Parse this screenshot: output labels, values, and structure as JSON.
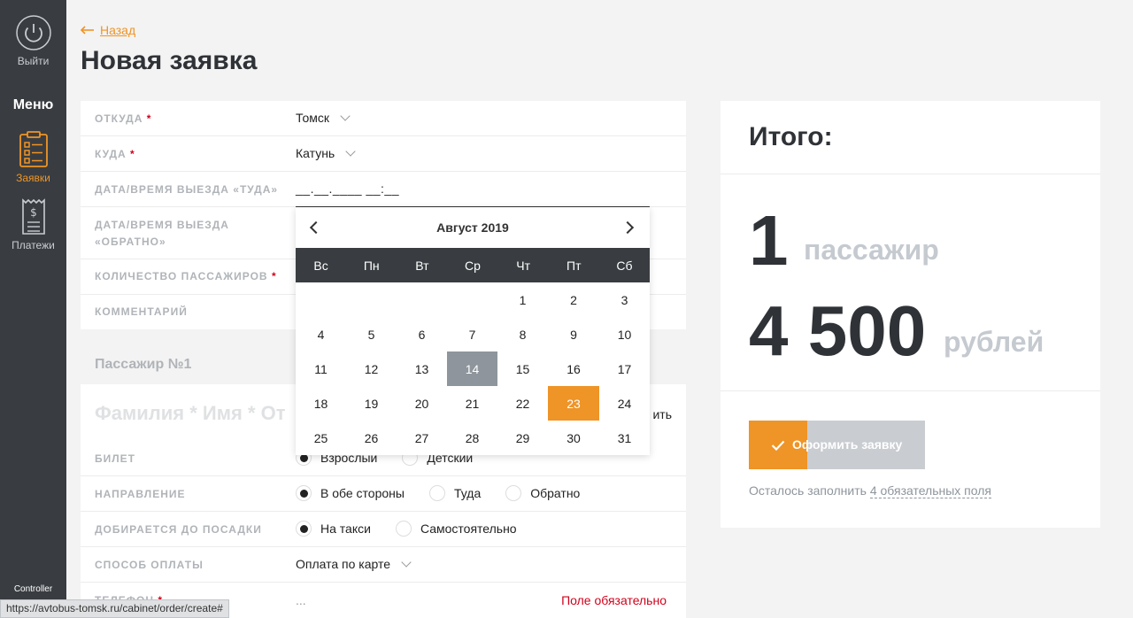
{
  "sidebar": {
    "logout_label": "Выйти",
    "menu_title": "Меню",
    "orders_label": "Заявки",
    "payments_label": "Платежи",
    "controller_label": "Controller"
  },
  "header": {
    "back_label": "Назад",
    "title": "Новая заявка"
  },
  "form": {
    "from_label": "ОТКУДА",
    "from_value": "Томск",
    "to_label": "КУДА",
    "to_value": "Катунь",
    "depart_label": "ДАТА/ВРЕМЯ ВЫЕЗДА «ТУДА»",
    "depart_value": "__.__.____ __:__",
    "return_label_1": "ДАТА/ВРЕМЯ ВЫЕЗДА",
    "return_label_2": "«ОБРАТНО»",
    "passengers_label": "КОЛИЧЕСТВО ПАССАЖИРОВ",
    "comment_label": "КОММЕНТАРИЙ",
    "required_mark": "*"
  },
  "passenger": {
    "heading": "Пассажир №1",
    "name_placeholder": "Фамилия * Имя * От",
    "right_link": "ить",
    "ticket_label": "БИЛЕТ",
    "ticket_options": [
      "Взрослый",
      "Детский"
    ],
    "direction_label": "НАПРАВЛЕНИЕ",
    "direction_options": [
      "В обе стороны",
      "Туда",
      "Обратно"
    ],
    "arrival_label": "ДОБИРАЕТСЯ ДО ПОСАДКИ",
    "arrival_options": [
      "На такси",
      "Самостоятельно"
    ],
    "payment_label": "СПОСОБ ОПЛАТЫ",
    "payment_value": "Оплата по карте",
    "phone_label": "ТЕЛЕФОН",
    "phone_value": "...",
    "phone_error": "Поле обязательно"
  },
  "calendar": {
    "month_label": "Август 2019",
    "weekdays": [
      "Вс",
      "Пн",
      "Вт",
      "Ср",
      "Чт",
      "Пт",
      "Сб"
    ],
    "leading_blanks": 4,
    "days_in_month": 31,
    "today": 14,
    "selected": 23
  },
  "summary": {
    "title": "Итого:",
    "passengers_count": "1",
    "passengers_unit": "пассажир",
    "price": "4 500",
    "price_unit": "рублей",
    "submit_label": "Оформить заявку",
    "remain_text": "Осталось заполнить",
    "remain_link": "4 обязательных поля"
  },
  "statusbar": {
    "url": "https://avtobus-tomsk.ru/cabinet/order/create#"
  },
  "colors": {
    "accent": "#ef9426",
    "sidebar": "#393d41",
    "error": "#d0021b"
  }
}
